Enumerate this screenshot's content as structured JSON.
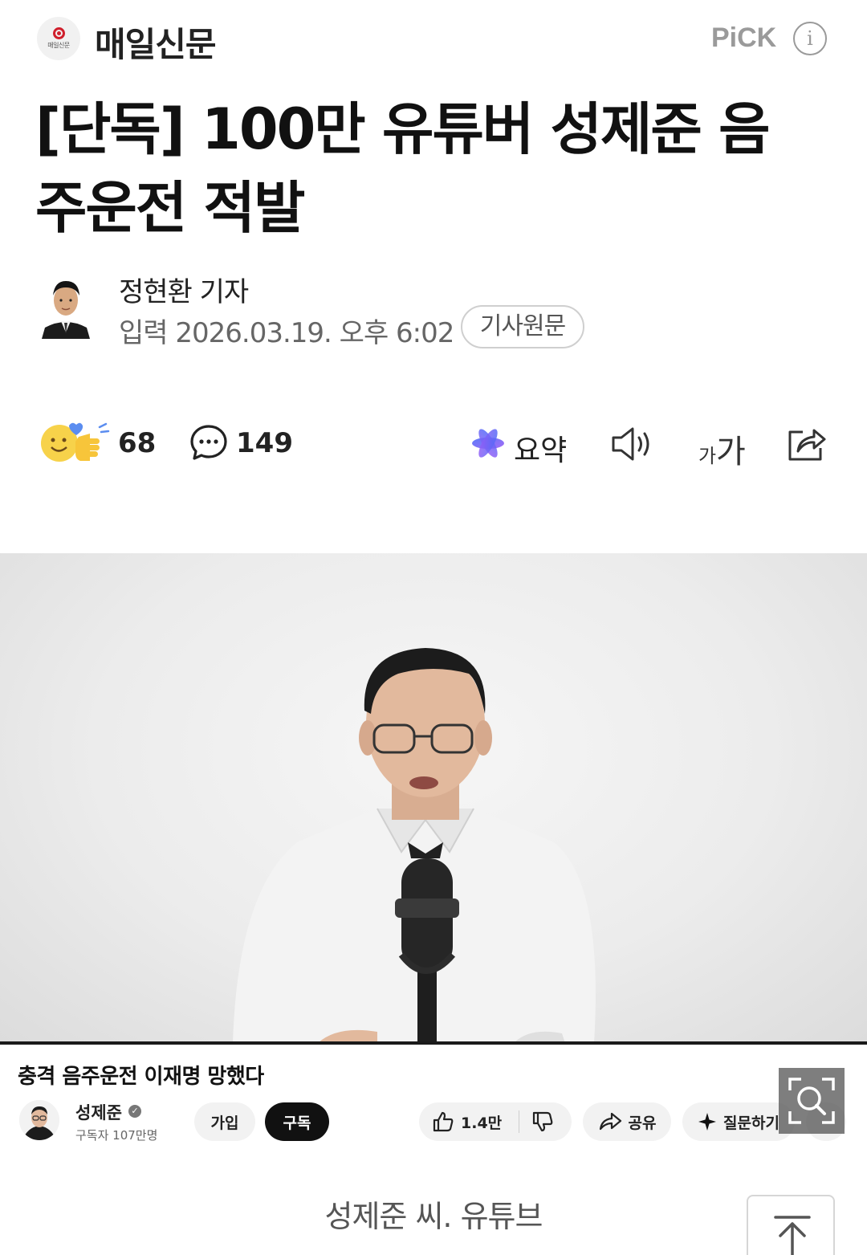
{
  "header": {
    "press_logo_text": "매일신문",
    "press_name": "매일신문",
    "pick_label": "PiCK",
    "info_icon": "info-icon"
  },
  "article": {
    "title_line1": "[단독] 100만 유튜버 성제준 음",
    "title_line2": "주운전 적발",
    "reporter": "정현환 기자",
    "date_label": "입력",
    "date": "2026.03.19. 오후 6:02",
    "original_button": "기사원문"
  },
  "actions": {
    "reaction_count": "68",
    "comment_count": "149",
    "summary_label": "요약",
    "font_small": "가",
    "font_big": "가",
    "icons": [
      "reaction-icon",
      "comment-icon",
      "summary-icon",
      "speaker-icon",
      "font-size-icon",
      "share-icon"
    ]
  },
  "video": {
    "title": "충격 음주운전 이재명 망했다",
    "channel": "성제준",
    "verified_mark": "✓",
    "subscribers": "구독자 107만명",
    "join_label": "가입",
    "subscribe_label": "구독",
    "like_count": "1.4만",
    "share_label": "공유",
    "ask_label": "질문하기"
  },
  "caption": "성제준 씨. 유튜브",
  "colors": {
    "accent": "#d01f2c",
    "pick_gray": "#9a9a9a",
    "summary_blue": "#4a6cf7",
    "summary_purple": "#9b5cf6"
  }
}
